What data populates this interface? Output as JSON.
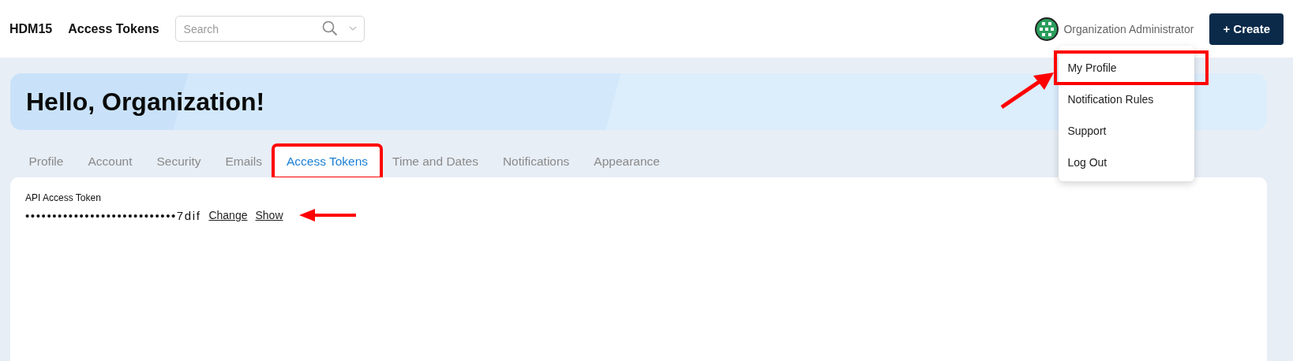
{
  "header": {
    "org": "HDM15",
    "page_title": "Access Tokens",
    "search": {
      "placeholder": "Search"
    },
    "user": "Organization Administrator",
    "create_button": "+ Create"
  },
  "user_menu": {
    "open": true,
    "items": [
      {
        "label": "My Profile",
        "highlighted": true,
        "pointer": true
      },
      {
        "label": "Notification Rules",
        "highlighted": false,
        "pointer": false
      },
      {
        "label": "Support",
        "highlighted": false,
        "pointer": false
      },
      {
        "label": "Log Out",
        "highlighted": false,
        "pointer": false
      }
    ]
  },
  "banner": {
    "greeting": "Hello, Organization!"
  },
  "tabs": [
    {
      "label": "Profile",
      "selected": false,
      "highlighted": false
    },
    {
      "label": "Account",
      "selected": false,
      "highlighted": false
    },
    {
      "label": "Security",
      "selected": false,
      "highlighted": false
    },
    {
      "label": "Emails",
      "selected": false,
      "highlighted": false
    },
    {
      "label": "Access Tokens",
      "selected": true,
      "highlighted": true
    },
    {
      "label": "Time and Dates",
      "selected": false,
      "highlighted": false
    },
    {
      "label": "Notifications",
      "selected": false,
      "highlighted": false
    },
    {
      "label": "Appearance",
      "selected": false,
      "highlighted": false
    }
  ],
  "token": {
    "label": "API Access Token",
    "value": "••••••••••••••••••••••••••••7dif",
    "links": [
      "Change",
      "Show"
    ],
    "pointer": true
  }
}
